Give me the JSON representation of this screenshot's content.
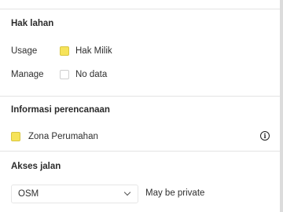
{
  "land_rights": {
    "title": "Hak lahan",
    "rows": [
      {
        "label": "Usage",
        "value": "Hak Milik",
        "swatch_color": "#f6e35a"
      },
      {
        "label": "Manage",
        "value": "No data",
        "swatch_color": "#ffffff"
      }
    ]
  },
  "planning": {
    "title": "Informasi perencanaan",
    "item": {
      "value": "Zona Perumahan",
      "swatch_color": "#f6e35a"
    },
    "info_icon": "info-icon"
  },
  "road_access": {
    "title": "Akses jalan",
    "select_value": "OSM",
    "status": "May be private"
  }
}
